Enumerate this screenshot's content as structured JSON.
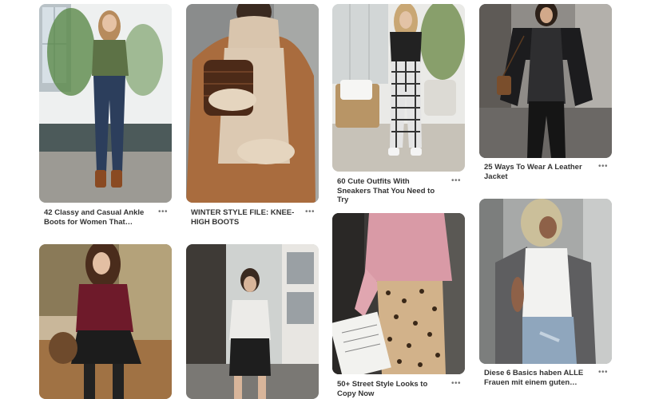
{
  "pins": [
    {
      "id": "boots",
      "caption": "42 Classy and Casual Ankle Boots for Women That…",
      "icon": "more-icon"
    },
    {
      "id": "winter",
      "caption": "WINTER STYLE FILE: KNEE-HIGH BOOTS",
      "icon": "more-icon"
    },
    {
      "id": "sneakers",
      "caption": "60 Cute Outfits With Sneakers That You Need to Try",
      "icon": "more-icon"
    },
    {
      "id": "leather",
      "caption": "25 Ways To Wear A Leather Jacket",
      "icon": "more-icon"
    },
    {
      "id": "maroon",
      "caption": "",
      "icon": ""
    },
    {
      "id": "street-skirt",
      "caption": "",
      "icon": ""
    },
    {
      "id": "leopard",
      "caption": "50+ Street Style Looks to Copy Now",
      "icon": "more-icon"
    },
    {
      "id": "basics",
      "caption": "Diese 6 Basics haben ALLE Frauen mit einem guten…",
      "icon": "more-icon"
    }
  ],
  "more_glyph": "•••"
}
